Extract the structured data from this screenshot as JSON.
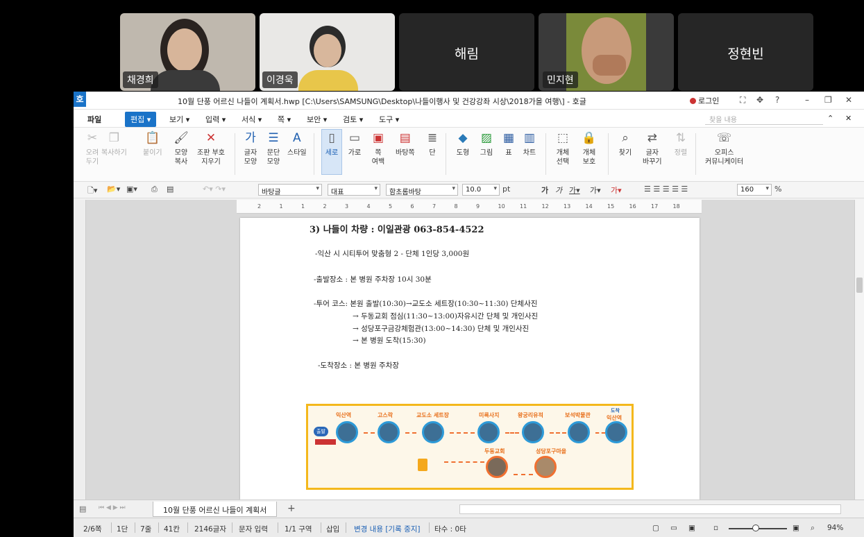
{
  "participants": [
    {
      "name": "채경희",
      "video": true
    },
    {
      "name": "이경욱",
      "video": true
    },
    {
      "name": "해림",
      "video": false
    },
    {
      "name": "민지현",
      "video": true
    },
    {
      "name": "정현빈",
      "video": false
    }
  ],
  "window": {
    "title": "10월 단풍 어르신 나들이 계획서.hwp [C:\\Users\\SAMSUNG\\Desktop\\나들이행사 및 건강강좌 시상\\2018가을 여행\\] - 호글",
    "login": "로그인",
    "app_icon": "호"
  },
  "menu": {
    "file": "파일",
    "edit": "편집",
    "items": [
      "보기",
      "입력",
      "서식",
      "쪽",
      "보안",
      "검토",
      "도구"
    ],
    "search_placeholder": "찾을 내용"
  },
  "ribbon": {
    "buttons": [
      {
        "label": "오려\n두기",
        "icon": "scissors-icon",
        "enabled": false
      },
      {
        "label": "복사하기",
        "icon": "copy-icon",
        "enabled": false
      },
      {
        "label": "붙이기",
        "icon": "paste-icon",
        "enabled": false
      },
      {
        "label": "모양\n복사",
        "icon": "format-painter-icon",
        "enabled": true
      },
      {
        "label": "조판 부호\n지우기",
        "icon": "clear-codes-icon",
        "enabled": true
      },
      {
        "label": "글자\n모양",
        "icon": "char-shape-icon",
        "enabled": true
      },
      {
        "label": "문단\n모양",
        "icon": "para-shape-icon",
        "enabled": true
      },
      {
        "label": "스타일",
        "icon": "style-icon",
        "enabled": true
      },
      {
        "label": "세로",
        "icon": "portrait-icon",
        "enabled": true
      },
      {
        "label": "가로",
        "icon": "landscape-icon",
        "enabled": true
      },
      {
        "label": "쪽\n여백",
        "icon": "margin-icon",
        "enabled": true
      },
      {
        "label": "바탕쪽",
        "icon": "master-page-icon",
        "enabled": true
      },
      {
        "label": "단",
        "icon": "columns-icon",
        "enabled": true
      },
      {
        "label": "도형",
        "icon": "shape-icon",
        "enabled": true
      },
      {
        "label": "그림",
        "icon": "picture-icon",
        "enabled": true
      },
      {
        "label": "표",
        "icon": "table-icon",
        "enabled": true
      },
      {
        "label": "차트",
        "icon": "chart-icon",
        "enabled": true
      },
      {
        "label": "개체\n선택",
        "icon": "select-object-icon",
        "enabled": true
      },
      {
        "label": "개체\n보호",
        "icon": "protect-object-icon",
        "enabled": true
      },
      {
        "label": "찾기",
        "icon": "find-icon",
        "enabled": true
      },
      {
        "label": "글자\n바꾸기",
        "icon": "replace-char-icon",
        "enabled": true
      },
      {
        "label": "정렬",
        "icon": "sort-icon",
        "enabled": false
      },
      {
        "label": "오피스\n커뮤니케이터",
        "icon": "office-communicator-icon",
        "enabled": true
      }
    ]
  },
  "format": {
    "style": "바탕글",
    "lang": "대표",
    "font": "함초롬바탕",
    "size": "10.0",
    "size_unit": "pt",
    "zoom": "160",
    "zoom_unit": "%"
  },
  "document": {
    "heading": "3) 나들이 차량 : 이일관광  063-854-4522",
    "lines": [
      "-익산 시 시티투어 맞춤형 2 -  단체 1인당 3,000원",
      "-출발장소 : 본 병원 주차장  10시 30분",
      "-투어 코스: 본원 출발(10:30)→교도소 세트장(10:30~11:30) 단체사진",
      "→ 두동교회 점심(11:30~13:00)자유시간 단체 및 개인사진",
      "→ 성당포구금강체험관(13:00~14:30) 단체 및 개인사진",
      "→ 본 병원 도착(15:30)",
      "-도착장소 : 본 병원 주차장"
    ],
    "route": {
      "start_badge": "출발",
      "stops": [
        "익산역",
        "고스락",
        "교도소 세트장",
        "미륵사지",
        "왕궁리유적",
        "보석박물관",
        "익산역"
      ],
      "lower_stops": [
        "두동교회",
        "성당포구마을"
      ],
      "end_badge": "도착"
    }
  },
  "ruler_ticks": [
    "2",
    "1",
    "1",
    "2",
    "3",
    "4",
    "5",
    "6",
    "7",
    "8",
    "9",
    "10",
    "11",
    "12",
    "13",
    "14",
    "15",
    "16",
    "17",
    "18"
  ],
  "tabs": {
    "doc_tab": "10월 단풍 어르신 나들이 계획서",
    "add": "+"
  },
  "status": {
    "page": "2/6쪽",
    "column": "1단",
    "line": "7줄",
    "col": "41칸",
    "chars": "2146글자",
    "mode": "문자 입력",
    "section": "1/1 구역",
    "insert": "삽입",
    "track": "변경 내용 [기록 중지]",
    "typing": "타수 : 0타",
    "zoom": "94%"
  }
}
